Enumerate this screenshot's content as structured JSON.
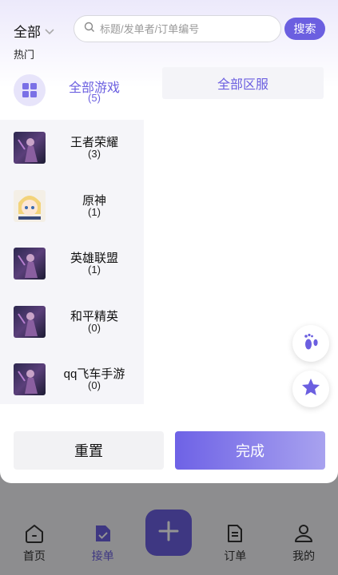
{
  "header": {
    "region_label": "全部",
    "search_placeholder": "标题/发单者/订单编号",
    "search_button": "搜索",
    "hot_label": "热门"
  },
  "all_games": {
    "label": "全部游戏",
    "count": "(5)"
  },
  "all_servers_label": "全部区服",
  "games": [
    {
      "name": "王者荣耀",
      "count": "(3)"
    },
    {
      "name": "原神",
      "count": "(1)"
    },
    {
      "name": "英雄联盟",
      "count": "(1)"
    },
    {
      "name": "和平精英",
      "count": "(0)"
    },
    {
      "name": "qq飞车手游",
      "count": "(0)"
    }
  ],
  "actions": {
    "reset": "重置",
    "done": "完成"
  },
  "bottom_nav": [
    {
      "label": "首页",
      "icon": "home-icon"
    },
    {
      "label": "接单",
      "icon": "order-accept-icon",
      "active": true
    },
    {
      "label": "",
      "icon": "plus-icon"
    },
    {
      "label": "订单",
      "icon": "document-icon"
    },
    {
      "label": "我的",
      "icon": "profile-icon"
    }
  ],
  "colors": {
    "accent": "#6b5fe0",
    "accent_light": "#e7e4fa"
  }
}
